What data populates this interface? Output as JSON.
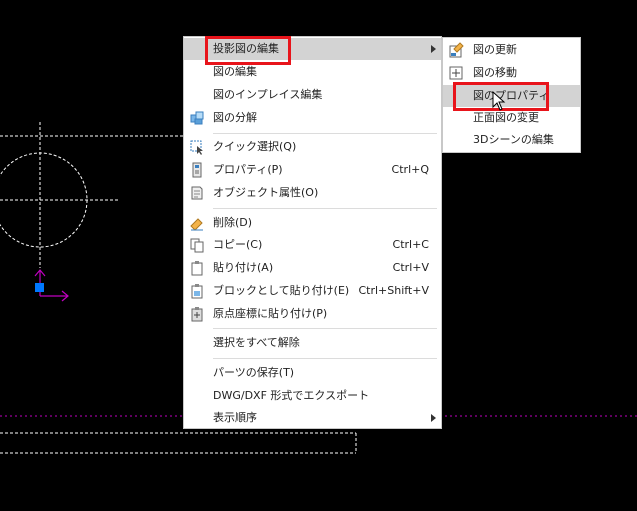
{
  "menu": {
    "items": [
      {
        "label": "投影図の編集",
        "icon": "none"
      },
      {
        "label": "図の編集",
        "icon": "none"
      },
      {
        "label": "図のインプレイス編集",
        "icon": "none"
      },
      {
        "label": "図の分解",
        "icon": "explode-icon"
      },
      {
        "label": "クイック選択(Q)",
        "icon": "quick-select-icon"
      },
      {
        "label": "プロパティ(P)",
        "shortcut": "Ctrl+Q",
        "icon": "properties-icon"
      },
      {
        "label": "オブジェクト属性(O)",
        "icon": "object-attribute-icon"
      },
      {
        "label": "削除(D)",
        "icon": "delete-icon"
      },
      {
        "label": "コピー(C)",
        "shortcut": "Ctrl+C",
        "icon": "copy-icon"
      },
      {
        "label": "貼り付け(A)",
        "shortcut": "Ctrl+V",
        "icon": "paste-icon"
      },
      {
        "label": "ブロックとして貼り付け(E)",
        "shortcut": "Ctrl+Shift+V",
        "icon": "paste-as-block-icon"
      },
      {
        "label": "原点座標に貼り付け(P)",
        "icon": "paste-at-origin-icon"
      },
      {
        "label": "選択をすべて解除",
        "icon": "none"
      },
      {
        "label": "パーツの保存(T)",
        "icon": "none"
      },
      {
        "label": "DWG/DXF 形式でエクスポート",
        "icon": "none"
      },
      {
        "label": "表示順序",
        "icon": "none"
      }
    ]
  },
  "submenu": {
    "items": [
      {
        "label": "図の更新",
        "icon": "update-view-icon"
      },
      {
        "label": "図の移動",
        "icon": "move-view-icon"
      },
      {
        "label": "図のプロパティ",
        "icon": "none"
      },
      {
        "label": "正面図の変更",
        "icon": "none"
      },
      {
        "label": "3Dシーンの編集",
        "icon": "none"
      }
    ]
  },
  "colors": {
    "highlight": "#d3d3d3",
    "annotation_red": "#e8141b",
    "cad_line": "#ffffff",
    "axis_magenta": "#c000c0",
    "origin_blue": "#0078ff"
  }
}
